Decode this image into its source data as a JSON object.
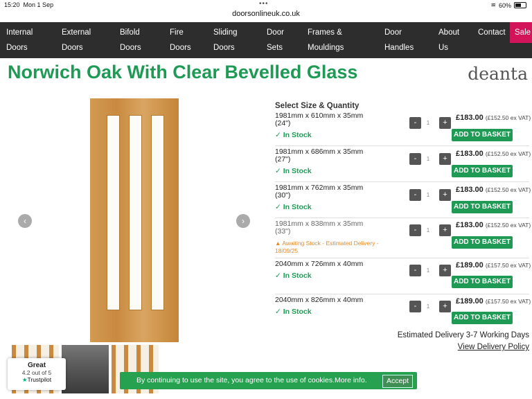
{
  "status": {
    "time": "15:20",
    "date": "Mon 1 Sep",
    "battery": "60%",
    "battery_level": 0.6
  },
  "browser": {
    "url": "doorsonlineuk.co.uk"
  },
  "nav": [
    {
      "line1": "Internal",
      "line2": "Doors"
    },
    {
      "line1": "External",
      "line2": "Doors"
    },
    {
      "line1": "Bifold",
      "line2": "Doors"
    },
    {
      "line1": "Fire",
      "line2": "Doors"
    },
    {
      "line1": "Sliding",
      "line2": "Doors"
    },
    {
      "line1": "Door",
      "line2": "Sets"
    },
    {
      "line1": "Frames &",
      "line2": "Mouldings"
    },
    {
      "line1": "Door",
      "line2": "Handles"
    },
    {
      "line1": "About",
      "line2": "Us"
    },
    {
      "line1": "Contact",
      "line2": ""
    }
  ],
  "nav_sale": "Sale",
  "product": {
    "title": "Norwich Oak With Clear Bevelled Glass",
    "brand": "deanta"
  },
  "options": {
    "heading": "Select Size & Quantity",
    "rows": [
      {
        "size": "1981mm x 610mm x 35mm",
        "inch": "(24\")",
        "stock": "In Stock",
        "qty": "1",
        "price": "£183.00",
        "exvat": "(£152.50 ex VAT)",
        "button": "ADD TO BASKET"
      },
      {
        "size": "1981mm x 686mm x 35mm",
        "inch": "(27\")",
        "stock": "In Stock",
        "qty": "1",
        "price": "£183.00",
        "exvat": "(£152.50 ex VAT)",
        "button": "ADD TO BASKET"
      },
      {
        "size": "1981mm x 762mm x 35mm",
        "inch": "(30\")",
        "stock": "In Stock",
        "qty": "1",
        "price": "£183.00",
        "exvat": "(£152.50 ex VAT)",
        "button": "ADD TO BASKET"
      },
      {
        "size": "1981mm x 838mm x 35mm",
        "inch": "(33\")",
        "stock": "Awaiting Stock - Estimated Delivery - 18/09/25",
        "qty": "1",
        "price": "£183.00",
        "exvat": "(£152.50 ex VAT)",
        "button": "ADD TO BASKET"
      },
      {
        "size": "2040mm x 726mm x 40mm",
        "inch": "",
        "stock": "In Stock",
        "qty": "1",
        "price": "£189.00",
        "exvat": "(£157.50 ex VAT)",
        "button": "ADD TO BASKET"
      },
      {
        "size": "2040mm x 826mm x 40mm",
        "inch": "",
        "stock": "In Stock",
        "qty": "1",
        "price": "£189.00",
        "exvat": "(£157.50 ex VAT)",
        "button": "ADD TO BASKET"
      }
    ]
  },
  "delivery": {
    "estimate": "Estimated Delivery 3-7 Working Days",
    "policy_link": "View Delivery Policy"
  },
  "trustpilot": {
    "rating_word": "Great",
    "score": "4.2 out of 5",
    "brand": "Trustpilot"
  },
  "cookie": {
    "message": "By continuing to use the site, you agree to the use of cookies.",
    "more": "More info.",
    "accept": "Accept"
  },
  "colors": {
    "brand_green": "#1f9a55",
    "nav_bg": "#2d2d2d",
    "sale_pink": "#d4145a",
    "awaiting_orange": "#e38a2b"
  }
}
